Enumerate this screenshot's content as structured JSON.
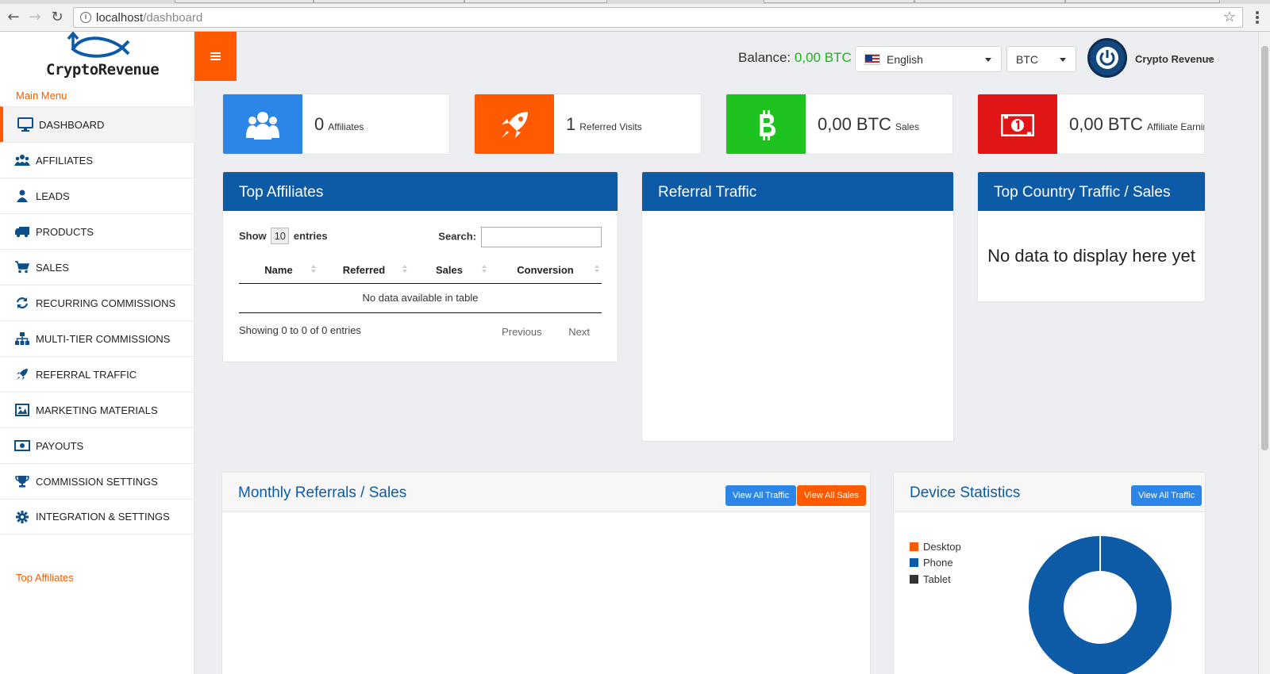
{
  "browser": {
    "url_host": "localhost",
    "url_path": "/dashboard"
  },
  "brand": {
    "name": "CryptoRevenue",
    "accent": "#ff5a00",
    "primary": "#0d5aa7"
  },
  "sidebar": {
    "menu_title": "Main Menu",
    "items": [
      {
        "label": "DASHBOARD",
        "icon": "desktop-icon"
      },
      {
        "label": "AFFILIATES",
        "icon": "users-icon"
      },
      {
        "label": "LEADS",
        "icon": "user-icon"
      },
      {
        "label": "PRODUCTS",
        "icon": "truck-icon"
      },
      {
        "label": "SALES",
        "icon": "cart-icon"
      },
      {
        "label": "RECURRING COMMISSIONS",
        "icon": "refresh-icon"
      },
      {
        "label": "MULTI-TIER COMMISSIONS",
        "icon": "sitemap-icon"
      },
      {
        "label": "REFERRAL TRAFFIC",
        "icon": "rocket-icon"
      },
      {
        "label": "MARKETING MATERIALS",
        "icon": "image-icon"
      },
      {
        "label": "PAYOUTS",
        "icon": "money-icon"
      },
      {
        "label": "COMMISSION SETTINGS",
        "icon": "trophy-icon"
      },
      {
        "label": "INTEGRATION & SETTINGS",
        "icon": "gear-icon"
      }
    ],
    "bottom_link": "Top Affiliates"
  },
  "header": {
    "balance_label": "Balance:",
    "balance_value": "0,00 BTC",
    "language": "English",
    "currency": "BTC",
    "user_name": "Crypto Revenue"
  },
  "stats": [
    {
      "value": "0",
      "label": "Affiliates",
      "color": "#2b86e8",
      "icon": "users-icon"
    },
    {
      "value": "1",
      "label": "Referred Visits",
      "color": "#ff5a00",
      "icon": "rocket-icon"
    },
    {
      "value": "0,00 BTC",
      "label": "Sales",
      "color": "#1fc31f",
      "icon": "bitcoin-icon"
    },
    {
      "value": "0,00 BTC",
      "label": "Affiliate Earnings",
      "color": "#e01515",
      "icon": "money-icon"
    }
  ],
  "top_affiliates": {
    "title": "Top Affiliates",
    "show_label": "Show",
    "entries_value": "10",
    "entries_label": "entries",
    "search_label": "Search:",
    "columns": [
      "Name",
      "Referred",
      "Sales",
      "Conversion"
    ],
    "empty_text": "No data available in table",
    "info": "Showing 0 to 0 of 0 entries",
    "prev": "Previous",
    "next": "Next"
  },
  "referral_traffic": {
    "title": "Referral Traffic"
  },
  "top_country": {
    "title": "Top Country Traffic / Sales",
    "empty_text": "No data to display here yet"
  },
  "monthly": {
    "title": "Monthly Referrals / Sales",
    "btn_traffic": "View All Traffic",
    "btn_sales": "View All Sales"
  },
  "devices": {
    "title": "Device Statistics",
    "btn_traffic": "View All Traffic",
    "legend": [
      {
        "label": "Desktop",
        "color": "#ff5a00"
      },
      {
        "label": "Phone",
        "color": "#0d5aa7"
      },
      {
        "label": "Tablet",
        "color": "#333333"
      }
    ]
  }
}
